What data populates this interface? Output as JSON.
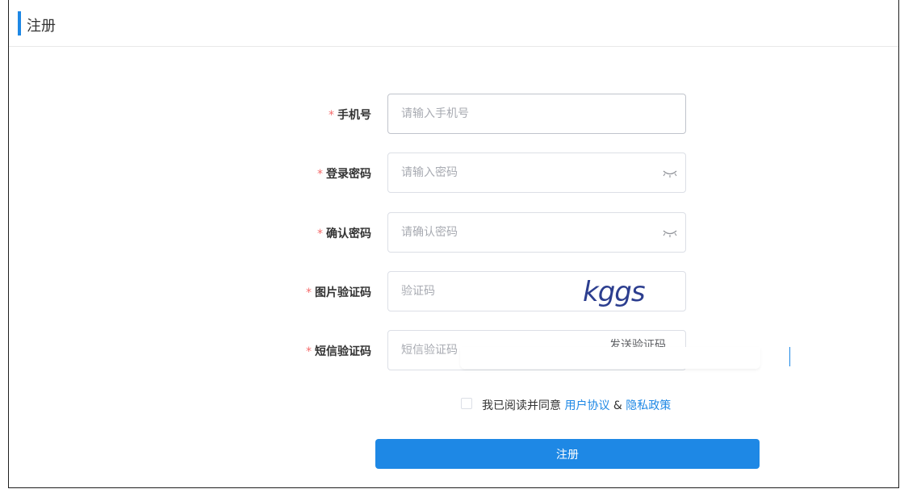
{
  "header": {
    "title": "注册"
  },
  "form": {
    "phone": {
      "required_mark": "*",
      "label": "手机号",
      "placeholder": "请输入手机号"
    },
    "password": {
      "required_mark": "*",
      "label": "登录密码",
      "placeholder": "请输入密码",
      "icon": "eye-closed-icon"
    },
    "confirm_password": {
      "required_mark": "*",
      "label": "确认密码",
      "placeholder": "请确认密码",
      "icon": "eye-closed-icon"
    },
    "captcha": {
      "required_mark": "*",
      "label": "图片验证码",
      "placeholder": "验证码",
      "image_text": "kggs"
    },
    "sms_code": {
      "required_mark": "*",
      "label": "短信验证码",
      "placeholder": "短信验证码",
      "send_label": "发送验证码"
    }
  },
  "agreement": {
    "prefix": "我已阅读并同意",
    "user_agreement": "用户协议",
    "separator": "&",
    "privacy_policy": "隐私政策"
  },
  "submit_label": "注册",
  "colors": {
    "accent": "#1e88e5",
    "required": "#f56c6c",
    "border": "#dcdfe6"
  }
}
